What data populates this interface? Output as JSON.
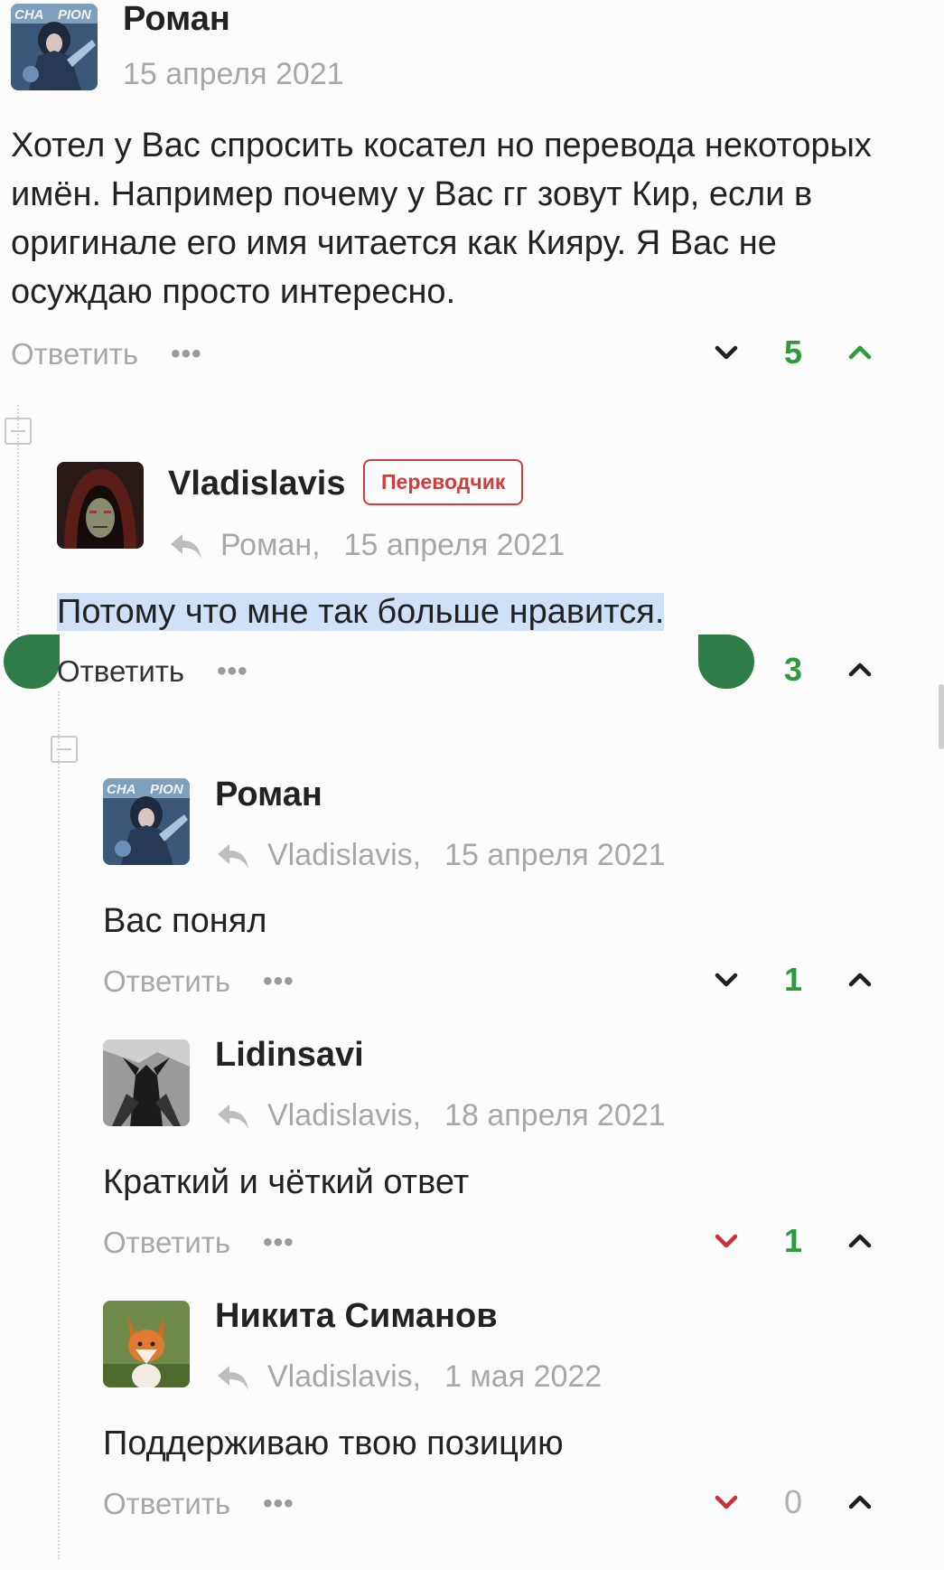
{
  "comments": [
    {
      "author": "Роман",
      "date": "15 апреля 2021",
      "text": "Хотел у Вас спросить косател но перевода некоторых имён. Например почему у Вас гг зовут Кир, если в оригинале его имя читается как Кияру. Я Вас не осуждаю просто интересно.",
      "reply_label": "Ответить",
      "more": "•••",
      "score": "5"
    },
    {
      "author": "Vladislavis",
      "badge": "Переводчик",
      "reply_to": "Роман,",
      "date": "15 апреля 2021",
      "text": "Потому что мне так больше нравится.",
      "reply_label": "Ответить",
      "more": "•••",
      "score": "3"
    },
    {
      "author": "Роман",
      "reply_to": "Vladislavis,",
      "date": "15 апреля 2021",
      "text": "Вас понял",
      "reply_label": "Ответить",
      "more": "•••",
      "score": "1"
    },
    {
      "author": "Lidinsavi",
      "reply_to": "Vladislavis,",
      "date": "18 апреля 2021",
      "text": "Краткий и чёткий ответ",
      "reply_label": "Ответить",
      "more": "•••",
      "score": "1"
    },
    {
      "author": "Никита Симанов",
      "reply_to": "Vladislavis,",
      "date": "1 мая 2022",
      "text": "Поддерживаю твою позицию",
      "reply_label": "Ответить",
      "more": "•••",
      "score": "0"
    }
  ],
  "colors": {
    "positive_score": "#2f9a3d",
    "zero_score": "#b0b0b0",
    "badge": "#d63b3b",
    "downvote_active": "#c9303a",
    "selection": "#cfe0f7"
  },
  "icons": {
    "downvote": "chevron-down-icon",
    "upvote": "chevron-up-icon",
    "reply_to": "reply-arrow-icon",
    "collapse": "collapse-minus-icon"
  }
}
